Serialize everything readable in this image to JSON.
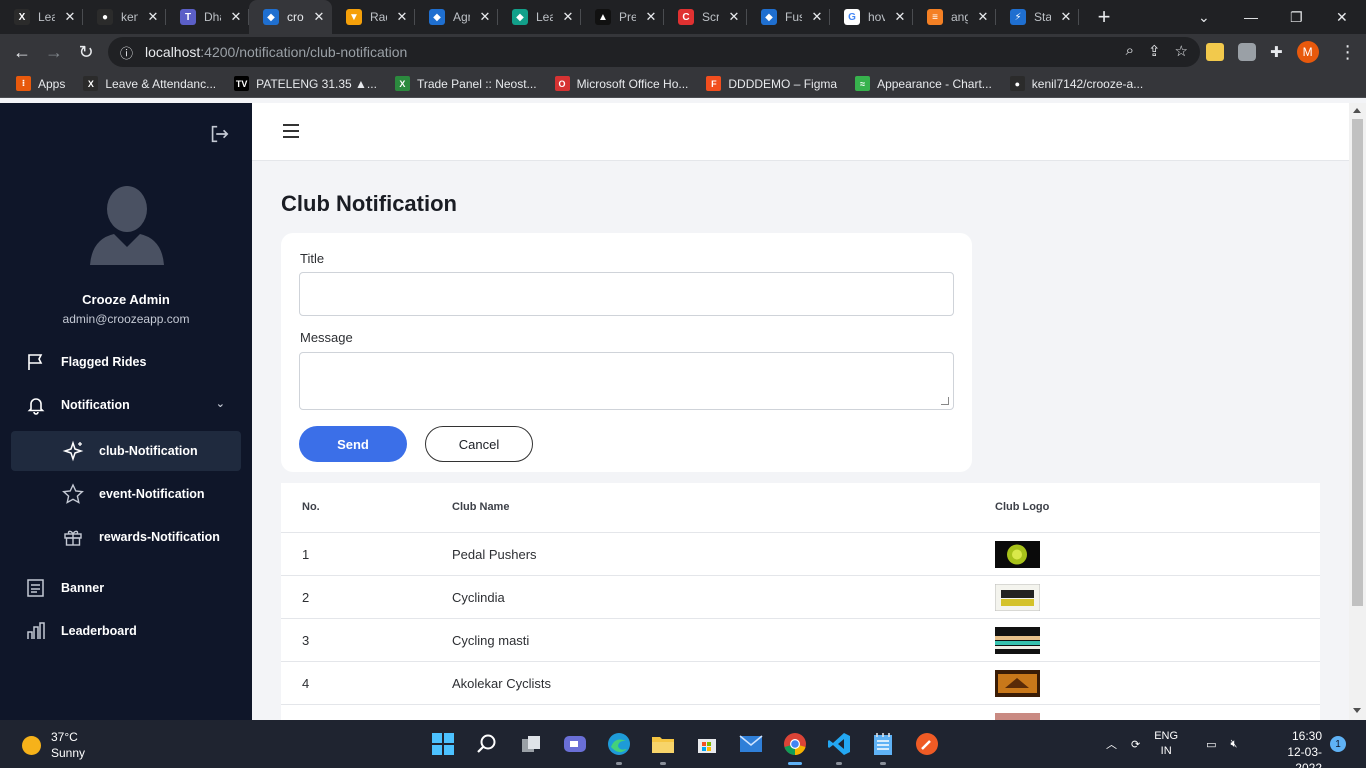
{
  "browser": {
    "tabs": [
      {
        "title": "Lea",
        "fav_bg": "#2b2b2b",
        "fav_text": "X"
      },
      {
        "title": "ken",
        "fav_bg": "#2b2b2b",
        "fav_text": "●"
      },
      {
        "title": "Dha",
        "fav_bg": "#5b5fc7",
        "fav_text": "T"
      },
      {
        "title": "cro",
        "fav_bg": "#1f6fd0",
        "fav_text": "◆"
      },
      {
        "title": "Rad",
        "fav_bg": "#f5a00a",
        "fav_text": "▼"
      },
      {
        "title": "Agr",
        "fav_bg": "#1f6fd0",
        "fav_text": "◆"
      },
      {
        "title": "Lea",
        "fav_bg": "#12a08a",
        "fav_text": "◆"
      },
      {
        "title": "Pre",
        "fav_bg": "#111111",
        "fav_text": "▲"
      },
      {
        "title": "Scr",
        "fav_bg": "#e03131",
        "fav_text": "C"
      },
      {
        "title": "Fus",
        "fav_bg": "#1f6fd0",
        "fav_text": "◆"
      },
      {
        "title": "hov",
        "fav_bg": "#ffffff",
        "fav_text": "G"
      },
      {
        "title": "ang",
        "fav_bg": "#f48024",
        "fav_text": "≡"
      },
      {
        "title": "Sta",
        "fav_bg": "#1f6fd0",
        "fav_text": "⚡"
      }
    ],
    "active_tab_index": 3,
    "url_host": "localhost",
    "url_path": ":4200/notification/club-notification",
    "profile_initial": "M",
    "bookmarks": [
      {
        "label": "Apps",
        "bg": "#e8590c",
        "text": "⁝"
      },
      {
        "label": "Leave & Attendanc...",
        "bg": "#2b2b2b",
        "text": "X"
      },
      {
        "label": "PATELENG 31.35 ▲...",
        "bg": "#000000",
        "text": "TV"
      },
      {
        "label": "Trade Panel :: Neost...",
        "bg": "#2b8a3e",
        "text": "X"
      },
      {
        "label": "Microsoft Office Ho...",
        "bg": "#d63333",
        "text": "O"
      },
      {
        "label": "DDDDEMO – Figma",
        "bg": "#f24e1e",
        "text": "F"
      },
      {
        "label": "Appearance - Chart...",
        "bg": "#37b24d",
        "text": "≈"
      },
      {
        "label": "kenil7142/crooze-a...",
        "bg": "#2b2b2b",
        "text": "●"
      }
    ]
  },
  "sidebar": {
    "admin_name": "Crooze Admin",
    "admin_email": "admin@croozeapp.com",
    "items": {
      "flagged": "Flagged Rides",
      "notification": "Notification",
      "club": "club-Notification",
      "event": "event-Notification",
      "rewards": "rewards-Notification",
      "banner": "Banner",
      "leaderboard": "Leaderboard"
    }
  },
  "main": {
    "page_title": "Club Notification",
    "form": {
      "title_label": "Title",
      "title_value": "",
      "message_label": "Message",
      "message_value": "",
      "send_label": "Send",
      "cancel_label": "Cancel"
    },
    "table": {
      "headers": {
        "no": "No.",
        "name": "Club Name",
        "logo": "Club Logo"
      },
      "rows": [
        {
          "no": "1",
          "name": "Pedal Pushers"
        },
        {
          "no": "2",
          "name": "Cyclindia"
        },
        {
          "no": "3",
          "name": "Cycling masti"
        },
        {
          "no": "4",
          "name": "Akolekar Cyclists"
        }
      ]
    }
  },
  "taskbar": {
    "temperature": "37°C",
    "condition": "Sunny",
    "lang_line1": "ENG",
    "lang_line2": "IN",
    "time": "16:30",
    "date": "12-03-2022",
    "notification_count": "1"
  },
  "colors": {
    "sidebar_bg": "#0f1629",
    "accent": "#3b6fe8"
  }
}
